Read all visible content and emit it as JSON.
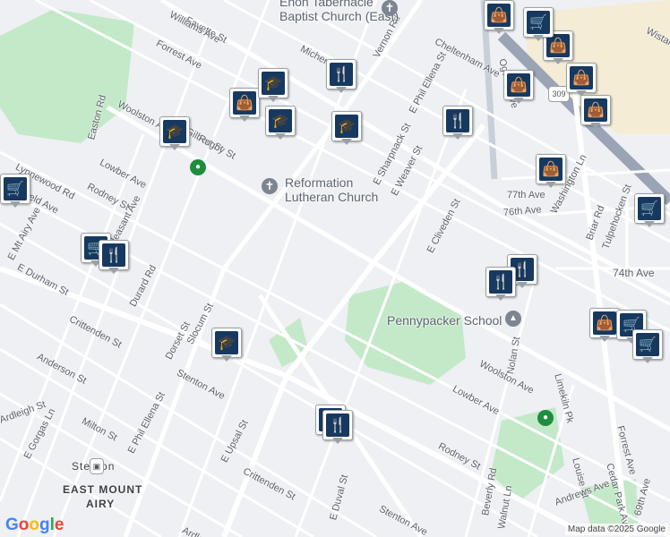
{
  "map": {
    "attribution": "Map data ©2025 Google",
    "logo": "Google",
    "colors": {
      "park": "#c3e9c9",
      "commercial": "#f5ecd6",
      "road": "#ffffff",
      "highway": "#9aa4b4",
      "marker": "#17395f"
    }
  },
  "places": [
    {
      "label": "Enon Tabernacle"
    },
    {
      "label": "Baptist Church (East)"
    },
    {
      "label": "Reformation"
    },
    {
      "label": "Lutheran Church"
    },
    {
      "label": "Pennypacker School"
    }
  ],
  "streets": [
    "Fayette St",
    "Williams Ave",
    "Forrest Ave",
    "Michener",
    "Vernon Rd",
    "Cheltenham Ave",
    "E Phil Ellena St",
    "Easton Rd",
    "Woolston Ave",
    "Gilbert St",
    "Rugby St",
    "Lowber Ave",
    "Lynnewood Rd",
    "Mansfield Ave",
    "Rodney St",
    "Pleasant Ave",
    "E Mt Airy Ave",
    "E Durham St",
    "Durard Rd",
    "Crittenden St",
    "Slocum St",
    "Dorset St",
    "Stenton Ave",
    "Anderson St",
    "E Upsal St",
    "Ardleigh St",
    "Milton St",
    "E Gorgas Ln",
    "E Phil Ellena St",
    "E Sharpnack St",
    "E Weaver St",
    "E Cliveden St",
    "Ogontz Ave",
    "Washington Ln",
    "77th Ave",
    "76th Ave",
    "Briar Rd",
    "Tulpehocken St",
    "74th Ave",
    "Limekiln Pk",
    "Nolan St",
    "Woolston Ave",
    "Lowber Ave",
    "Rodney St",
    "Forrest Ave",
    "Cedar Park Ave",
    "Louise St",
    "Andrews Ave",
    "Beverly Rd",
    "Walnut Ln",
    "E Duval St",
    "Crittenden St",
    "69th Ave",
    "Wistar",
    "Stenton Ave",
    "Ardleigh"
  ],
  "areas": [
    "Stenton",
    "EAST MOUNT",
    "AIRY"
  ],
  "route_shield": "309",
  "markers": [
    {
      "type": "shopping",
      "icon": "shopping-bag-icon"
    },
    {
      "type": "shopping",
      "icon": "shopping-bag-icon"
    },
    {
      "type": "shopping",
      "icon": "shopping-bag-icon"
    },
    {
      "type": "shopping",
      "icon": "shopping-bag-icon"
    },
    {
      "type": "shopping",
      "icon": "shopping-bag-icon"
    },
    {
      "type": "shopping",
      "icon": "shopping-bag-icon"
    },
    {
      "type": "shopping",
      "icon": "shopping-bag-icon"
    },
    {
      "type": "shopping",
      "icon": "shopping-bag-icon"
    },
    {
      "type": "shopping",
      "icon": "shopping-bag-icon"
    },
    {
      "type": "cart",
      "icon": "shopping-cart-icon"
    },
    {
      "type": "cart",
      "icon": "shopping-cart-icon"
    },
    {
      "type": "cart",
      "icon": "shopping-cart-icon"
    },
    {
      "type": "cart",
      "icon": "shopping-cart-icon"
    },
    {
      "type": "cart",
      "icon": "shopping-cart-icon"
    },
    {
      "type": "cart",
      "icon": "shopping-cart-icon"
    },
    {
      "type": "restaurant",
      "icon": "fork-knife-icon"
    },
    {
      "type": "restaurant",
      "icon": "fork-knife-icon"
    },
    {
      "type": "restaurant",
      "icon": "fork-knife-icon"
    },
    {
      "type": "restaurant",
      "icon": "fork-knife-icon"
    },
    {
      "type": "restaurant",
      "icon": "fork-knife-icon"
    },
    {
      "type": "restaurant",
      "icon": "fork-knife-icon"
    },
    {
      "type": "restaurant",
      "icon": "fork-knife-icon"
    },
    {
      "type": "school",
      "icon": "graduation-cap-icon"
    },
    {
      "type": "school",
      "icon": "graduation-cap-icon"
    },
    {
      "type": "school",
      "icon": "graduation-cap-icon"
    },
    {
      "type": "school",
      "icon": "graduation-cap-icon"
    },
    {
      "type": "school",
      "icon": "graduation-cap-icon"
    }
  ]
}
